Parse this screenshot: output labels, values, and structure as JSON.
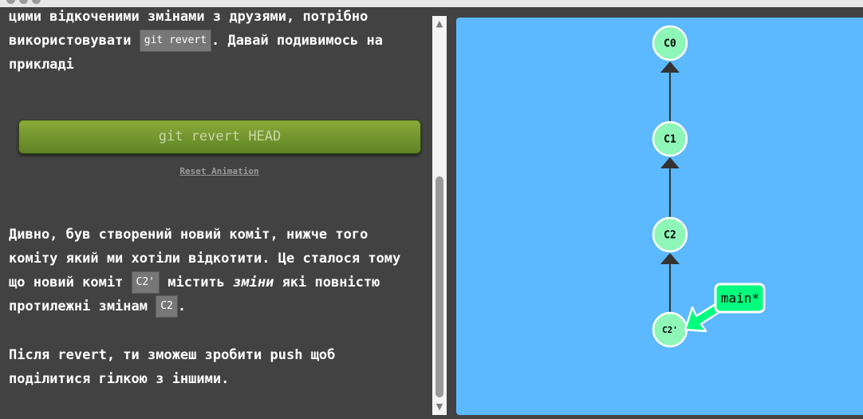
{
  "intro": {
    "line1": "цими відкоченими змінами з друзями, потрібно",
    "line2_before": "використовувати ",
    "line2_code": "git revert",
    "line2_after": ". Давай подивимось на",
    "line3": "прикладі"
  },
  "command_button": {
    "label": "git revert HEAD"
  },
  "reset_link": {
    "label": "Reset Animation"
  },
  "explanation": {
    "line1": "Дивно, був створений новий коміт, нижче того",
    "line2": "коміту який ми хотіли відкотити. Це сталося тому",
    "line3_before": "що новий коміт ",
    "line3_code": "C2'",
    "line3_middle": " містить ",
    "line3_em": "зміни",
    "line3_after": " які повністю",
    "line4_before": "протилежні змінам ",
    "line4_code": "C2",
    "line4_after": "."
  },
  "outro": {
    "line1": "Після revert, ти зможеш зробити push щоб",
    "line2": "поділитися гілкою з іншими."
  },
  "scrollbar": {
    "up_icon": "▲",
    "down_icon": "▼"
  },
  "graph": {
    "commits": [
      {
        "id": "C0",
        "label": "C0"
      },
      {
        "id": "C1",
        "label": "C1"
      },
      {
        "id": "C2",
        "label": "C2"
      },
      {
        "id": "C2p",
        "label": "C2'"
      }
    ],
    "branch": {
      "label": "main*",
      "color": "#00ff7f"
    },
    "colors": {
      "commit_fill": "#8ef7b8",
      "canvas_bg": "#5cb8ff"
    }
  }
}
